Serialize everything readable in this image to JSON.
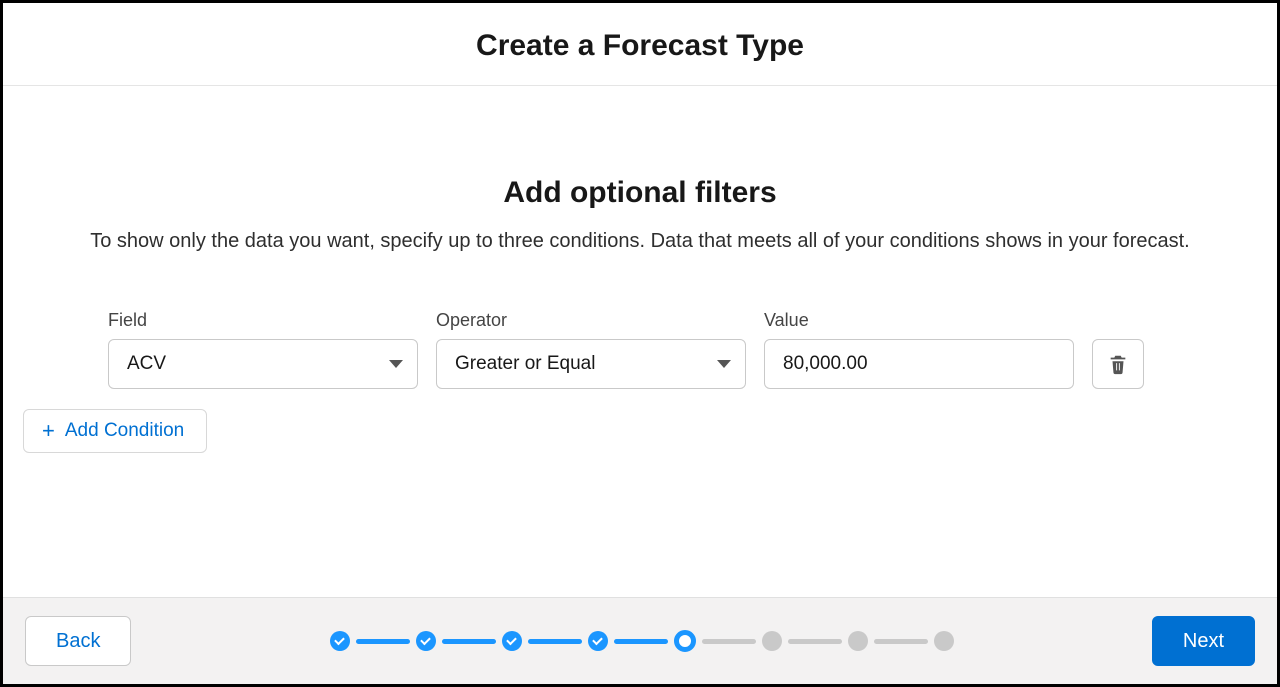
{
  "header": {
    "title": "Create a Forecast Type"
  },
  "section": {
    "title": "Add optional filters",
    "description": "To show only the data you want, specify up to three conditions. Data that meets all of your conditions shows in your forecast."
  },
  "labels": {
    "field": "Field",
    "operator": "Operator",
    "value": "Value"
  },
  "conditions": [
    {
      "field": "ACV",
      "operator": "Greater or Equal",
      "value": "80,000.00"
    }
  ],
  "buttons": {
    "add_condition": "Add Condition",
    "back": "Back",
    "next": "Next"
  },
  "progress": {
    "total_steps": 8,
    "current_step": 5,
    "steps": [
      "done",
      "done",
      "done",
      "done",
      "current",
      "future",
      "future",
      "future"
    ]
  }
}
